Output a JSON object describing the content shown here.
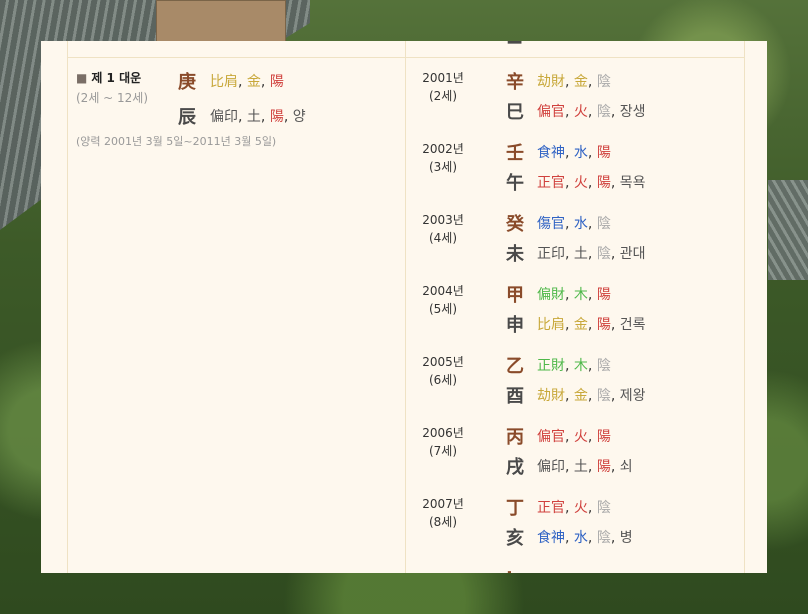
{
  "left": {
    "title": "제 1 대운",
    "age": "(2세 ~ 12세)",
    "date_range": "(양력 2001년 3월 5일~2011년 3월 5일)",
    "stem": {
      "char": "庚",
      "ten_god": "比肩",
      "element": "金",
      "yinyang": "陽"
    },
    "branch": {
      "char": "辰",
      "ten_god": "偏印",
      "element": "土",
      "yinyang": "陽",
      "stage": "양"
    }
  },
  "years": [
    {
      "year": "2001년",
      "age": "(2세)",
      "stem": {
        "char": "辛",
        "ten_god": "劫財",
        "element": "金",
        "yinyang": "陰"
      },
      "branch": {
        "char": "巳",
        "ten_god": "偏官",
        "element": "火",
        "yinyang": "陰",
        "stage": "장생"
      }
    },
    {
      "year": "2002년",
      "age": "(3세)",
      "stem": {
        "char": "壬",
        "ten_god": "食神",
        "element": "水",
        "yinyang": "陽"
      },
      "branch": {
        "char": "午",
        "ten_god": "正官",
        "element": "火",
        "yinyang": "陽",
        "stage": "목욕"
      }
    },
    {
      "year": "2003년",
      "age": "(4세)",
      "stem": {
        "char": "癸",
        "ten_god": "傷官",
        "element": "水",
        "yinyang": "陰"
      },
      "branch": {
        "char": "未",
        "ten_god": "正印",
        "element": "土",
        "yinyang": "陰",
        "stage": "관대"
      }
    },
    {
      "year": "2004년",
      "age": "(5세)",
      "stem": {
        "char": "甲",
        "ten_god": "偏財",
        "element": "木",
        "yinyang": "陽"
      },
      "branch": {
        "char": "申",
        "ten_god": "比肩",
        "element": "金",
        "yinyang": "陽",
        "stage": "건록"
      }
    },
    {
      "year": "2005년",
      "age": "(6세)",
      "stem": {
        "char": "乙",
        "ten_god": "正財",
        "element": "木",
        "yinyang": "陰"
      },
      "branch": {
        "char": "酉",
        "ten_god": "劫財",
        "element": "金",
        "yinyang": "陰",
        "stage": "제왕"
      }
    },
    {
      "year": "2006년",
      "age": "(7세)",
      "stem": {
        "char": "丙",
        "ten_god": "偏官",
        "element": "火",
        "yinyang": "陽"
      },
      "branch": {
        "char": "戌",
        "ten_god": "偏印",
        "element": "土",
        "yinyang": "陽",
        "stage": "쇠"
      }
    },
    {
      "year": "2007년",
      "age": "(8세)",
      "stem": {
        "char": "丁",
        "ten_god": "正官",
        "element": "火",
        "yinyang": "陰"
      },
      "branch": {
        "char": "亥",
        "ten_god": "食神",
        "element": "水",
        "yinyang": "陰",
        "stage": "병"
      }
    }
  ]
}
